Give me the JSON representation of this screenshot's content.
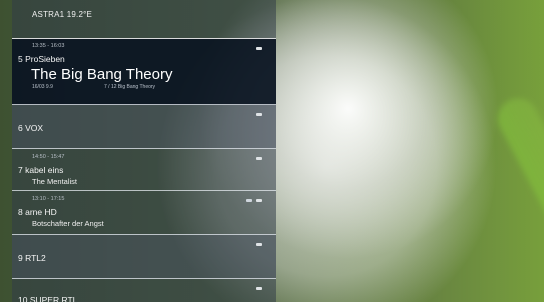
{
  "satellite": "ASTRA1 19.2°E",
  "channels": [
    {
      "number_name": "5 ProSieben",
      "time_range": "13:35 - 16:03",
      "program": "The Big Bang Theory",
      "meta_left": "16/03    9.9",
      "meta_right": "7 / 12 Big Bang Theory"
    },
    {
      "number_name": "6 VOX"
    },
    {
      "time_range": "14:50 - 15:47",
      "number_name": "7 kabel eins",
      "program": "The Mentalist"
    },
    {
      "time_range": "13:10 - 17:15",
      "number_name": "8 arne HD",
      "program": "Botschafter der Angst"
    },
    {
      "number_name": "9 RTL2"
    },
    {
      "number_name": "10 SUPER RTL"
    }
  ],
  "icons": {
    "badge_1": "info-badge",
    "badge_2": "hd-badge"
  }
}
